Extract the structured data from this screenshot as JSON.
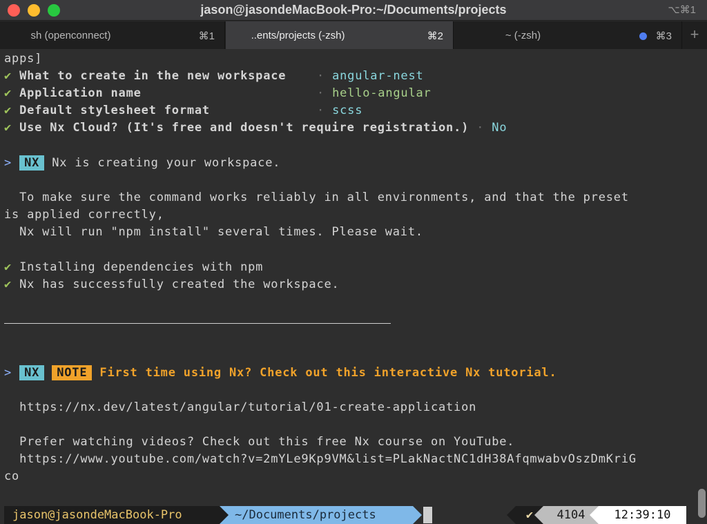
{
  "window": {
    "title": "jason@jasondeMacBook-Pro:~/Documents/projects",
    "shortcut": "⌥⌘1"
  },
  "tabs": [
    {
      "label": "sh (openconnect)",
      "shortcut": "⌘1",
      "active": false
    },
    {
      "label": "..ents/projects (-zsh)",
      "shortcut": "⌘2",
      "active": true
    },
    {
      "label": "~ (-zsh)",
      "shortcut": "⌘3",
      "active": false,
      "indicator_color": "#4f7df0"
    }
  ],
  "add_tab_label": "+",
  "terminal": {
    "line0": "apps]",
    "check": "✔",
    "sep": "·",
    "prompt": ">",
    "answers": [
      {
        "question": "What to create in the new workspace",
        "answer": "angular-nest"
      },
      {
        "question": "Application name",
        "answer": "hello-angular"
      },
      {
        "question": "Default stylesheet format",
        "answer": "scss"
      },
      {
        "question": "Use Nx Cloud? (It's free and doesn't require registration.)",
        "answer": "No"
      }
    ],
    "nx_badge": "NX",
    "creating": "Nx is creating your workspace.",
    "info1": "  To make sure the command works reliably in all environments, and that the preset",
    "info2": "is applied correctly,",
    "info3": "  Nx will run \"npm install\" several times. Please wait.",
    "done1": "Installing dependencies with npm",
    "done2": "Nx has successfully created the workspace.",
    "note_badge": "NOTE",
    "note_text": "First time using Nx? Check out this interactive Nx tutorial.",
    "tutorial_url": "  https://nx.dev/latest/angular/tutorial/01-create-application",
    "video_text": "  Prefer watching videos? Check out this free Nx course on YouTube.",
    "video_url": "  https://www.youtube.com/watch?v=2mYLe9Kp9VM&list=PLakNactNC1dH38AfqmwabvOszDmKriG",
    "video_url_cont": "co"
  },
  "status": {
    "user": "jason@jasondeMacBook-Pro",
    "dir": "~/Documents/projects",
    "ok": "✔",
    "history": "4104",
    "time": "12:39:10"
  },
  "colors": {
    "nx_badge": "#69c1cf",
    "note_badge": "#f0a22a",
    "check": "#9ec35b"
  }
}
